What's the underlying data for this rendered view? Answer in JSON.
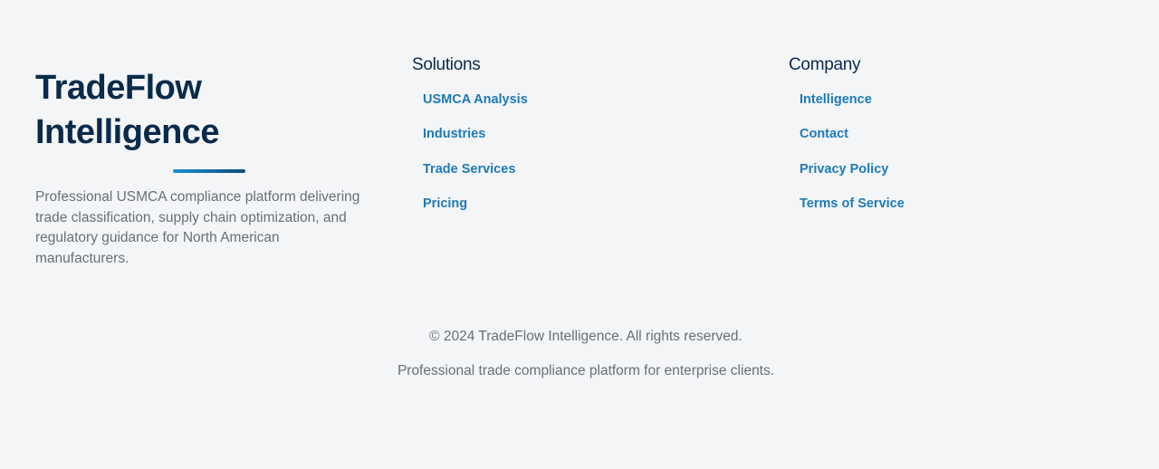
{
  "brand": {
    "title_line1": "TradeFlow",
    "title_line2": "Intelligence",
    "description": "Professional USMCA compliance platform delivering trade classification, supply chain optimization, and regulatory guidance for North American manufacturers."
  },
  "solutions": {
    "heading": "Solutions",
    "links": [
      "USMCA Analysis",
      "Industries",
      "Trade Services",
      "Pricing"
    ]
  },
  "company": {
    "heading": "Company",
    "links": [
      "Intelligence",
      "Contact",
      "Privacy Policy",
      "Terms of Service"
    ]
  },
  "bottom": {
    "copyright": "© 2024 TradeFlow Intelligence. All rights reserved.",
    "tagline": "Professional trade compliance platform for enterprise clients."
  },
  "colors": {
    "background": "#f3f5f7",
    "heading": "#0b2a4a",
    "link": "#1e7ab8",
    "muted_text": "#6b6f75",
    "accent_gradient_start": "#1a8fd0",
    "accent_gradient_end": "#0f4c7a"
  }
}
